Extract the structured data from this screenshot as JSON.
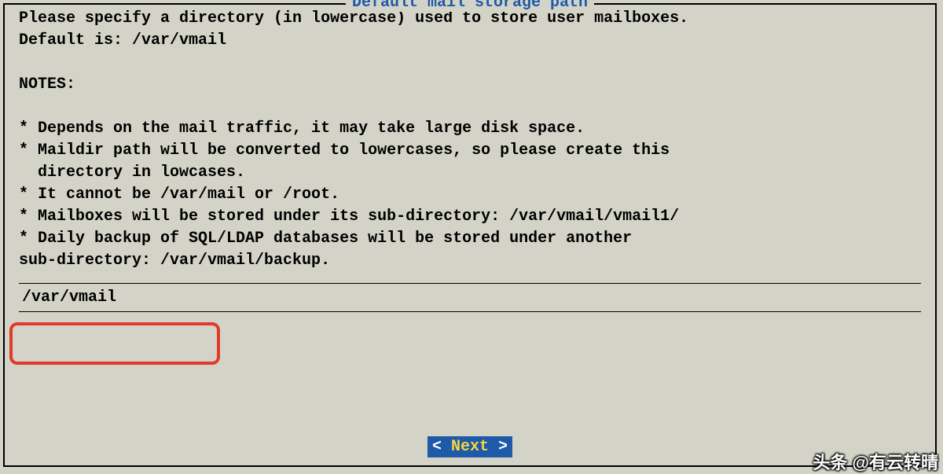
{
  "title": "Default mail storage path",
  "body_text": "Please specify a directory (in lowercase) used to store user mailboxes.\nDefault is: /var/vmail\n\nNOTES:\n\n* Depends on the mail traffic, it may take large disk space.\n* Maildir path will be converted to lowercases, so please create this\n  directory in lowcases.\n* It cannot be /var/mail or /root.\n* Mailboxes will be stored under its sub-directory: /var/vmail/vmail1/\n* Daily backup of SQL/LDAP databases will be stored under another\nsub-directory: /var/vmail/backup.",
  "input_value": "/var/vmail",
  "button": {
    "open": "< ",
    "n": "N",
    "ext": "ext",
    "close": " >"
  },
  "watermark": "头条 @有云转晴"
}
